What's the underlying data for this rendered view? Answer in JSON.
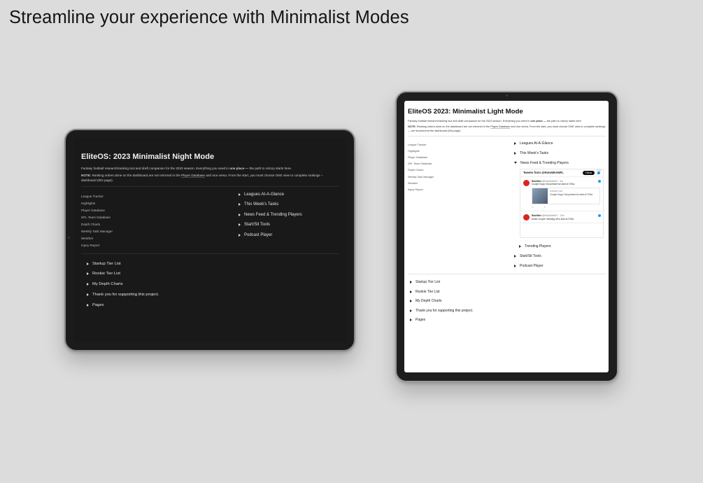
{
  "headline": "Streamline your experience with Minimalist Modes",
  "dark": {
    "title": "EliteOS: 2023 Minimalist Night Mode",
    "desc_before": "Fantasy football research/ranking tool and draft companion for the 2023 season. Everything you need in ",
    "desc_bold": "one place —",
    "desc_after": " the path to victory starts here.",
    "note_label": "NOTE:",
    "note_before": " Ranking orders done on the dashboard are not mirrored in the ",
    "note_link": "Player Database",
    "note_after": " and vice versa. From the start, you must choose ONE view to complete rankings – dashboard (this page).",
    "nav": [
      "League Tracker",
      "Highlights",
      "Player Database",
      "NFL Team Database",
      "Depth Charts",
      "Weekly Task Manager",
      "Weather",
      "Injury Report"
    ],
    "toggles": [
      "Leagues At-A-Glance",
      "This Week's Tasks",
      "News Feed & Trending Players",
      "Start/Sit Tools",
      "Podcast Player"
    ],
    "bottom": [
      "Startup Tier List",
      "Rookie Tier List",
      "My Depth Charts",
      "Thank you for supporting this project.",
      "Pages"
    ]
  },
  "light": {
    "title": "EliteOS 2023: Minimalist Light Mode",
    "desc_before": "Fantasy football research/ranking tool and draft companion for the 2023 season. Everything you need in ",
    "desc_bold": "one place —",
    "desc_after": " the path to victory starts here.",
    "note_label": "NOTE:",
    "note_before": " Ranking orders done on the dashboard are not mirrored in the ",
    "note_link": "Player Database",
    "note_after": " and vice versa. From the start, you must choose ONE view to complete rankings — we recommend the dashboard (this page).",
    "nav": [
      "League Tracker",
      "Highlights",
      "Player Database",
      "NFL Team Database",
      "Depth Charts",
      "Weekly Task Manager",
      "Weather",
      "Injury Report"
    ],
    "toggles_top": [
      "Leagues At-A-Glance",
      "This Week's Tasks",
      "News Feed & Trending Players"
    ],
    "nested_toggle": "Trending Players",
    "toggles_after": [
      "Start/Sit Tools",
      "Podcast Player"
    ],
    "bottom": [
      "Startup Tier List",
      "Rookie Tier List",
      "My Depth Charts",
      "Thank you for supporting this project.",
      "Pages"
    ],
    "twitter": {
      "header": "Tweets from @RotoWireNFL",
      "follow": "Follow",
      "tweet1_author": "RotoWire",
      "tweet1_handle": "@RotoWireNFL · 9m",
      "tweet1_text": "Cooper Kupp: Not present for start of OTAs",
      "card_domain": "rotowire.com",
      "card_text": "Cooper Kupp: Not present for start of OTAs",
      "tweet2_author": "RotoWire",
      "tweet2_handle": "@RotoWireNFL · 13m",
      "tweet2_text": "Amari Cooper: Working off to side at OTAs"
    }
  }
}
